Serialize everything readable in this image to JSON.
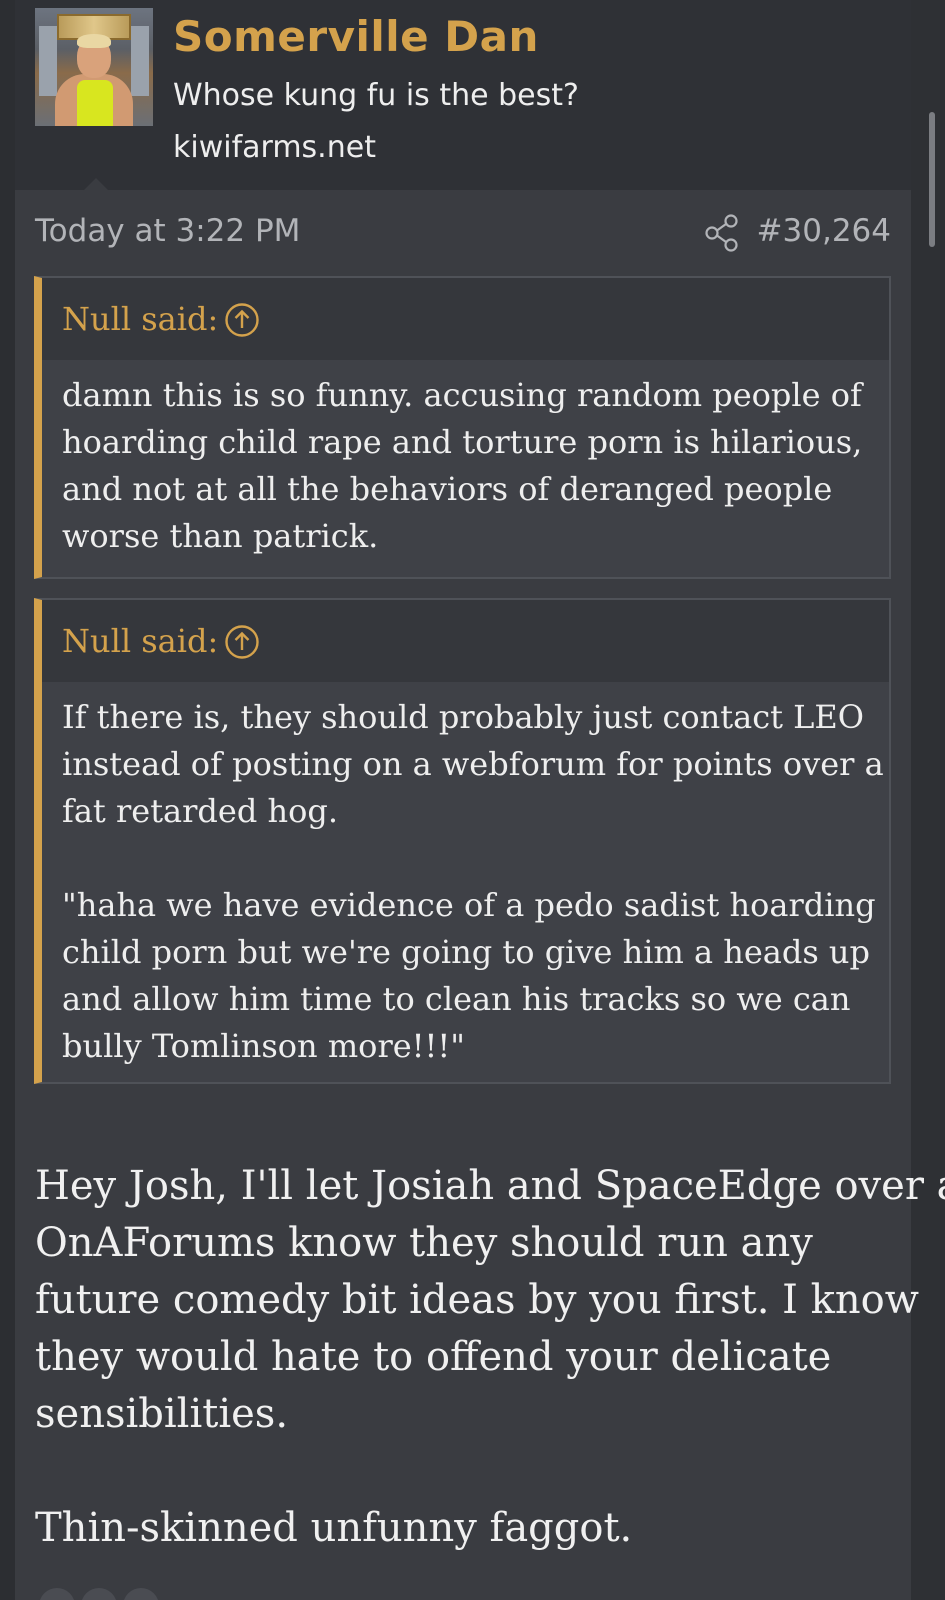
{
  "post": {
    "user": {
      "name": "Somerville Dan",
      "title": "Whose kung fu is the best?",
      "site": "kiwifarms.net",
      "avatar_icon": "avatar-wrestler"
    },
    "meta": {
      "date": "Today at 3:22 PM",
      "share_icon": "share-icon",
      "post_number": "#30,264"
    },
    "quotes": [
      {
        "author": "Null said:",
        "lines": [
          "damn this is so funny. accusing random people of",
          "hoarding child rape and torture porn is hilarious,",
          "and not at all the behaviors of deranged people",
          "worse than patrick."
        ]
      },
      {
        "author": "Null said:",
        "paragraph1": [
          "If there is, they should probably just contact LEO",
          "instead of posting on a webforum for points over a",
          "fat retarded hog."
        ],
        "paragraph2": [
          "\"haha we have evidence of a pedo sadist hoarding",
          "child porn but we're going to give him a heads up",
          "and allow him time to clean his tracks so we can",
          "bully Tomlinson more!!!\""
        ]
      }
    ],
    "message": {
      "paragraph1": [
        "Hey Josh, I'll let Josiah and SpaceEdge over at",
        "OnAForums know they should run any",
        "future comedy bit ideas by you first. I know",
        "they would hate to offend your delicate",
        "sensibilities."
      ],
      "paragraph2": [
        "Thin-skinned unfunny faggot."
      ]
    }
  },
  "colors": {
    "accent": "#d4a24c",
    "background": "#3a3c41",
    "header_bg": "#2f3136",
    "quote_bg": "#3f4147"
  }
}
